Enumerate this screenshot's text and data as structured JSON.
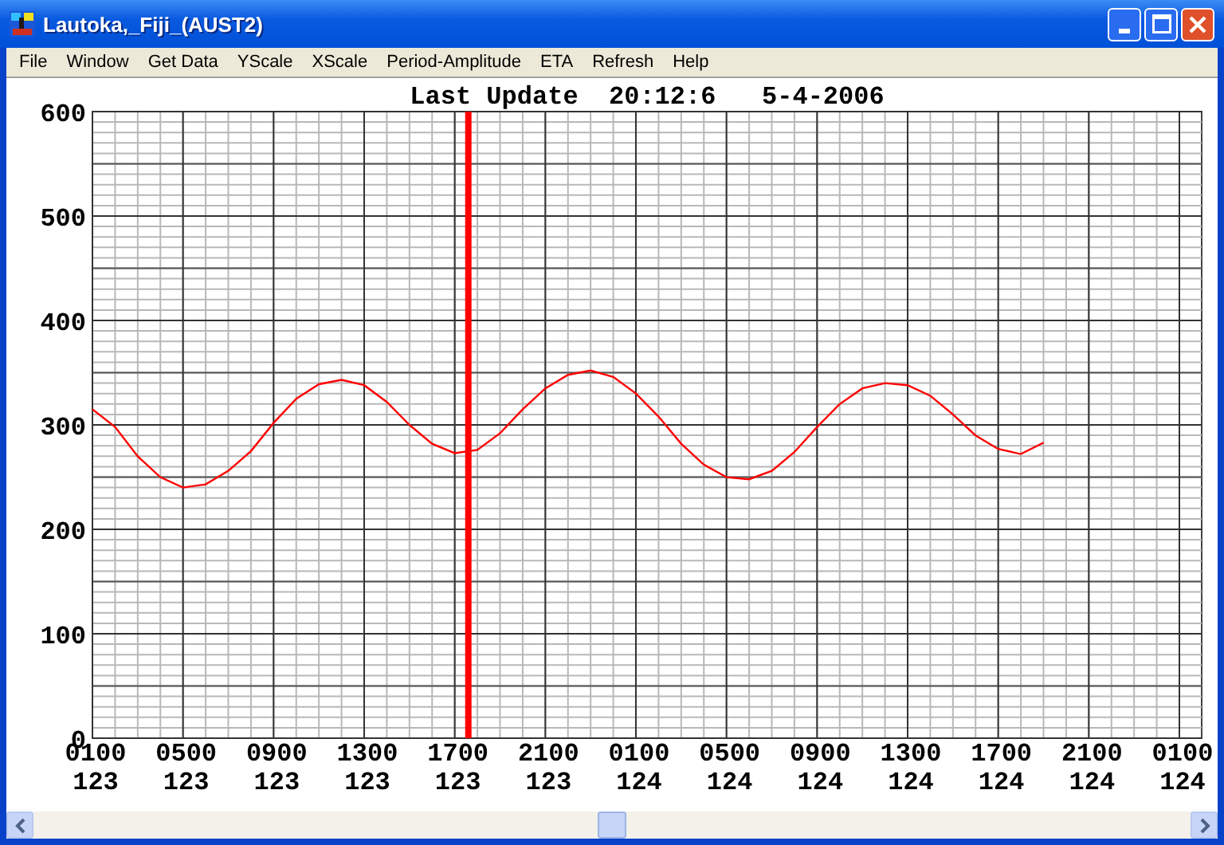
{
  "window": {
    "title": "Lautoka,_Fiji_(AUST2)"
  },
  "menu": [
    "File",
    "Window",
    "Get Data",
    "YScale",
    "XScale",
    "Period-Amplitude",
    "ETA",
    "Refresh",
    "Help"
  ],
  "chart": {
    "chart_data": {
      "type": "line",
      "title": "Last Update  20:12:6   5-4-2006",
      "categories": [
        "0100 123",
        null,
        null,
        null,
        "0500 123",
        null,
        null,
        null,
        "0900 123",
        null,
        null,
        null,
        "1300 123",
        null,
        null,
        null,
        "1700 123",
        null,
        null,
        null,
        "2100 123",
        null,
        null,
        null,
        "0100 124",
        null,
        null,
        null,
        "0500 124",
        null,
        null,
        null,
        "0900 124",
        null,
        null,
        null,
        "1300 124",
        null,
        null,
        null,
        "1700 124",
        null,
        null,
        null,
        "2100 124",
        null,
        null,
        null,
        "0100 124"
      ],
      "series": [
        {
          "color": "#ff0000",
          "values": [
            315,
            298,
            270,
            250,
            240,
            243,
            256,
            275,
            302,
            325,
            339,
            343,
            338,
            322,
            300,
            282,
            273,
            276,
            292,
            315,
            335,
            348,
            352,
            346,
            330,
            308,
            282,
            262,
            250,
            248,
            256,
            274,
            298,
            320,
            335,
            340,
            338,
            328,
            310,
            290,
            277,
            272,
            283,
            null,
            null,
            null,
            null,
            null,
            null
          ]
        }
      ],
      "ylim": [
        0,
        600
      ],
      "yticks": [
        0,
        100,
        200,
        300,
        400,
        500,
        600
      ],
      "grid": true
    }
  }
}
